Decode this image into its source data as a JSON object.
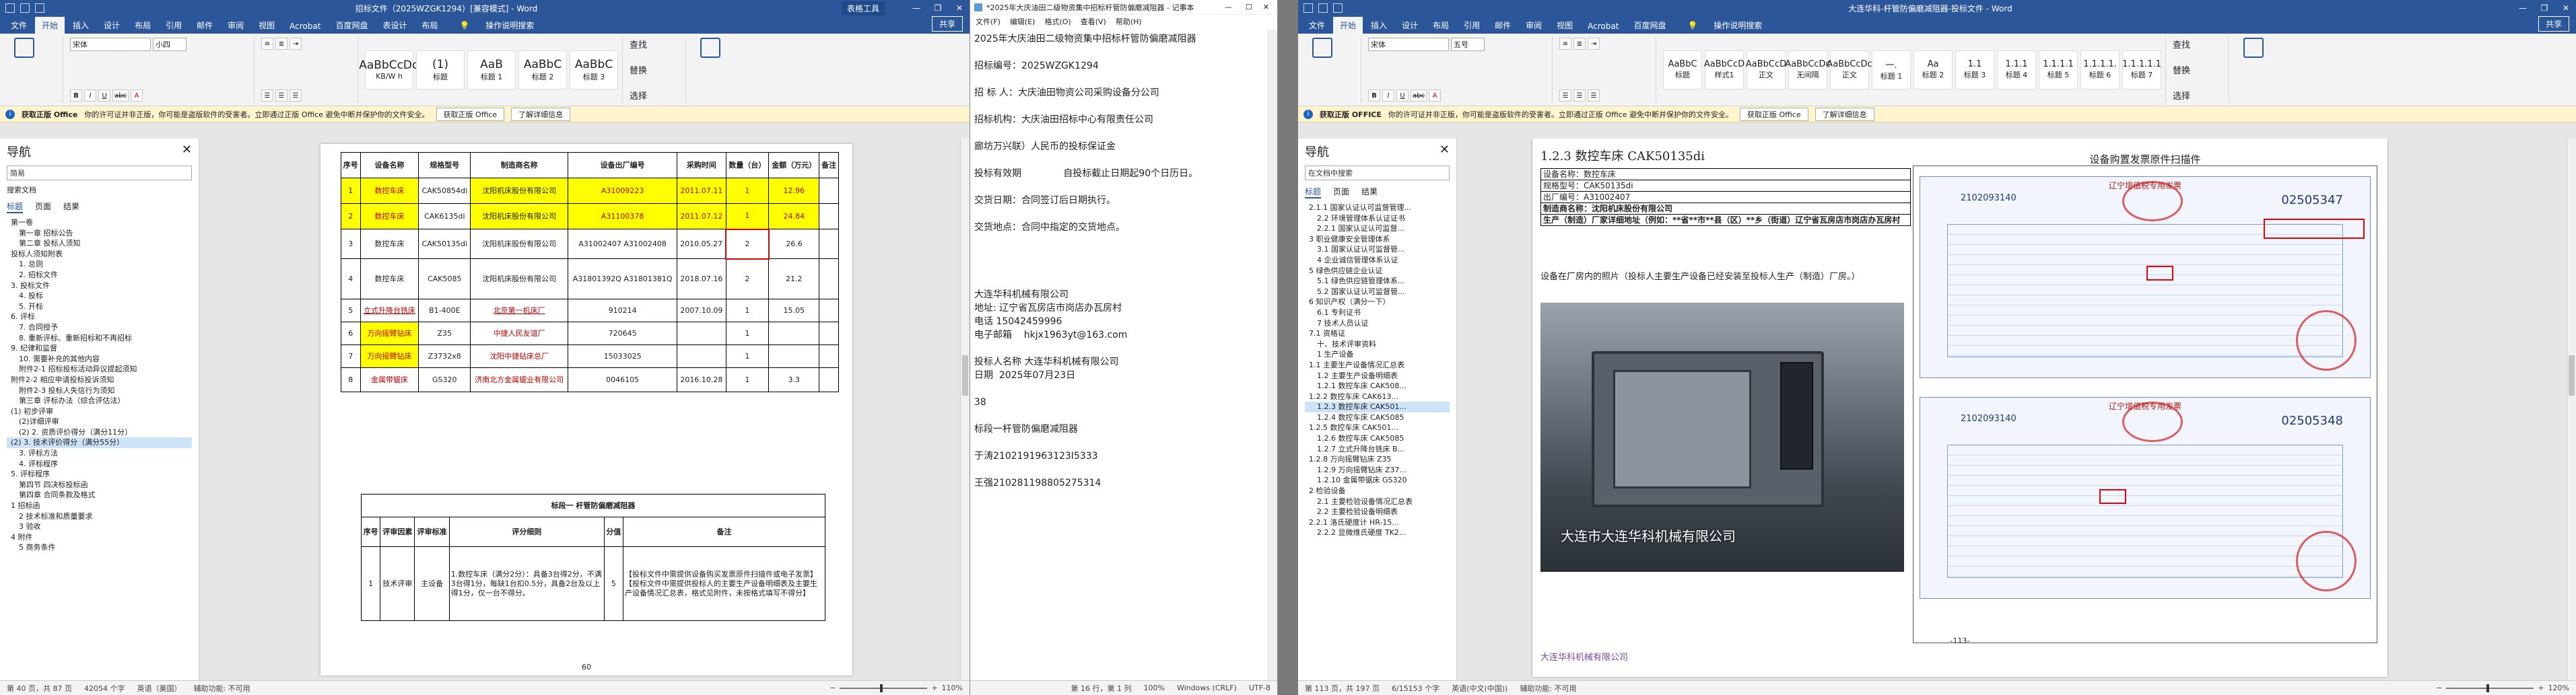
{
  "word1": {
    "title": "招标文件（2025WZGK1294）[兼容模式] - Word",
    "context_tab": "表格工具",
    "share": "共享",
    "tabs": [
      "文件",
      "开始",
      "插入",
      "设计",
      "布局",
      "引用",
      "邮件",
      "审阅",
      "视图",
      "Acrobat",
      "百度网盘",
      "表设计",
      "布局"
    ],
    "tell_me": "操作说明搜索",
    "font_name": "宋体",
    "font_size": "小四",
    "styles": [
      {
        "preview": "AaBbCcDd",
        "name": "KB/W h"
      },
      {
        "preview": "(1)",
        "name": "标题"
      },
      {
        "preview": "AaB",
        "name": "标题 1"
      },
      {
        "preview": "AaBbC",
        "name": "标题 2"
      },
      {
        "preview": "AaBbC",
        "name": "标题 3"
      }
    ],
    "edit_items": [
      "查找",
      "替换",
      "选择"
    ],
    "msg": {
      "label": "获取正版 Office",
      "text": "你的许可证并非正版，你可能是盗版软件的受害者。立即通过正版 Office 避免中断并保护你的文件安全。",
      "b1": "获取正版 Office",
      "b2": "了解详细信息"
    },
    "nav": {
      "title": "导航",
      "search": "简易",
      "hint": "搜索文档",
      "tabs": [
        "标题",
        "页面",
        "结果"
      ],
      "items": [
        "第一卷",
        "第一章 招标公告",
        "第二章 投标人须知",
        "投标人须知附表",
        "1. 总则",
        "2. 招标文件",
        "3. 投标文件",
        "4. 投标",
        "5. 开标",
        "6. 评标",
        "7. 合同授予",
        "8. 重新评标、重新招标和不再招标",
        "9. 纪律和监督",
        "10. 需要补充的其他内容",
        "附件2-1 招标投标活动异议提起须知",
        "附件2-2 相应申请投标投诉须知",
        "附件2-3 投标人失信行为须知",
        "第三章 评标办法（综合评估法）",
        "(1) 初步评审",
        "(2)详细评审",
        "(2) 2. 资质评价得分（满分11分）",
        "(2) 3. 技术评价得分（满分55分）",
        "3. 评标方法",
        "4. 评标程序",
        "5. 评标程序",
        "第四节 四决标投标函",
        "第四章 合同条款及格式",
        "1 招标函",
        "2 技术标准和质量要求",
        "3 验收",
        "4 附件",
        "5 商务条件"
      ],
      "selected": 21
    },
    "table": {
      "headers": [
        "序号",
        "设备名称",
        "规格型号",
        "制造商名称",
        "设备出厂编号",
        "采购时间",
        "数量（台）",
        "金额（万元）",
        "备注"
      ],
      "rows": [
        [
          "1",
          "数控车床",
          "CAK50854di",
          "沈阳机床股份有限公司",
          "A31009223",
          "2011.07.11",
          "1",
          "12.96",
          ""
        ],
        [
          "2",
          "数控车床",
          "CAK6135di",
          "沈阳机床股份有限公司",
          "A31100378",
          "2011.07.12",
          "1",
          "24.84",
          ""
        ],
        [
          "3",
          "数控车床",
          "CAK50135di",
          "沈阳机床股份有限公司",
          "A31002407 A31002408",
          "2010.05.27",
          "2",
          "26.6",
          ""
        ],
        [
          "4",
          "数控车床",
          "CAK5085",
          "沈阳机床股份有限公司",
          "A31801392Q A31801381Q",
          "2018.07.16",
          "2",
          "21.2",
          ""
        ],
        [
          "5",
          "立式升降台铣床",
          "B1-400E",
          "北京第一机床厂",
          "910214",
          "2007.10.09",
          "1",
          "15.05",
          ""
        ],
        [
          "6",
          "万向摇臂钻床",
          "Z35",
          "中捷人民友谊厂",
          "720645",
          "",
          "1",
          "",
          ""
        ],
        [
          "7",
          "万向摇臂钻床",
          "Z3732x8",
          "沈阳中捷钻床总厂",
          "15033025",
          "",
          "1",
          "",
          ""
        ],
        [
          "8",
          "金属带锯床",
          "GS320",
          "济南北方金属锯业有限公司",
          "0046105",
          "2016.10.28",
          "1",
          "3.3",
          ""
        ]
      ],
      "page_num": "60"
    },
    "table2": {
      "caption": "标段一 杆管防偏磨减阻器",
      "headers": [
        "序号",
        "评审因素",
        "评审标准",
        "评分细则",
        "分值",
        "备注"
      ],
      "cell_factor": "技术评审",
      "cell_sub": "主设备",
      "cell_rule": "1.数控车床（满分2分）：具备3台得2分，不满3台得1分，每缺1台扣0.5分，具备2台及以上得1分，仅一台不得分。",
      "cell_score": "5",
      "cell_note": "【投标文件中需提供设备购买发票原件扫描件或电子发票】【投标文件中需提供投标人的主要生产设备明细表及主要生产设备情况汇总表，格式见附件，未按格式填写不得分】"
    },
    "status": {
      "page": "第 40 页，共 87 页",
      "words": "42054 个字",
      "lang": "英语（美国）",
      "acc": "辅助功能: 不可用",
      "zoom": "110%"
    }
  },
  "notepad": {
    "title": "*2025年大庆油田二级物资集中招标杆管防偏磨减阻器 - 记事本",
    "menu": [
      "文件(F)",
      "编辑(E)",
      "格式(O)",
      "查看(V)",
      "帮助(H)"
    ],
    "lines": [
      "2025年大庆油田二级物资集中招标杆管防偏磨减阻器",
      "",
      "招标编号：2025WZGK1294",
      "",
      "招 标 人：大庆油田物资公司采购设备分公司",
      "",
      "招标机构：大庆油田招标中心有限责任公司",
      "",
      "廊坊万兴联）人民币的投标保证金",
      "",
      "投标有效期              自投标截止日期起90个日历日。",
      "",
      "交货日期：合同签订后日期执行。",
      "",
      "交货地点：合同中指定的交货地点。",
      "",
      "",
      "",
      "",
      "大连华科机械有限公司",
      "地址: 辽宁省瓦房店市岗店办瓦房村",
      "电话 15042459996",
      "电子邮箱    hkjx1963yt@163.com",
      "",
      "投标人名称 大连华科机械有限公司",
      "日期  2025年07月23日",
      "",
      "38",
      "",
      "标段一杆管防偏磨减阻器",
      "",
      "于涛2102191963123I5333",
      "",
      "王强210281198805275314"
    ],
    "status": {
      "pos": "第 16 行，第 1 列",
      "zoom": "100%",
      "enc": "Windows (CRLF)",
      "charset": "UTF-8"
    }
  },
  "word2": {
    "title": "大连华科-杆管防偏磨减阻器-投标文件 - Word",
    "share": "共享",
    "tabs": [
      "文件",
      "开始",
      "插入",
      "设计",
      "布局",
      "引用",
      "邮件",
      "审阅",
      "视图",
      "Acrobat",
      "百度网盘"
    ],
    "tell_me": "操作说明搜索",
    "font_name": "宋体",
    "font_size": "五号",
    "styles": [
      {
        "preview": "AaBbC",
        "name": "标题"
      },
      {
        "preview": "AaBbCcD",
        "name": "样式1"
      },
      {
        "preview": "AaBbCcD",
        "name": "正文"
      },
      {
        "preview": "AaBbCcDc",
        "name": "无间隔"
      },
      {
        "preview": "AaBbCcDc",
        "name": "正文"
      },
      {
        "preview": "一.",
        "name": "标题 1"
      },
      {
        "preview": "Aa",
        "name": "标题 2"
      },
      {
        "preview": "1.1",
        "name": "标题 3"
      },
      {
        "preview": "1.1.1",
        "name": "标题 4"
      },
      {
        "preview": "1.1.1.1",
        "name": "标题 5"
      },
      {
        "preview": "1.1.1.1.",
        "name": "标题 6"
      },
      {
        "preview": "1.1.1.1.1",
        "name": "标题 7"
      }
    ],
    "edit_items": [
      "查找",
      "替换",
      "选择"
    ],
    "msg": {
      "label": "获取正版 OFFICE",
      "text": "你的许可证并非正版，你可能是盗版软件的受害者。立即通过正版 Office 避免中断并保护你的文件安全。",
      "b1": "获取正版 Office",
      "b2": "了解详细信息"
    },
    "nav": {
      "title": "导航",
      "search": "在文档中搜索",
      "tabs": [
        "标题",
        "页面",
        "结果"
      ],
      "items": [
        "2.1.1 国家认证认可监督管理...",
        "2.2 环境管理体系认证证书",
        "2.2.1 国家认证认可监督...",
        "3 职业健康安全管理体系",
        "3.1 国家认证认可监督管...",
        "4 企业诚信管理体系认证",
        "5 绿色供应链企业认证",
        "5.1 绿色供应链管理体系...",
        "5.2 国家认证认可监督管...",
        "6 知识产权（满分一下）",
        "6.1 专利证书",
        "7 技术人员认证",
        "7.1 资格证",
        "十、技术评审资料",
        "1 生产设备",
        "1.1 主要生产设备情况汇总表",
        "1.2 主要生产设备明细表",
        "1.2.1 数控车床 CAK508...",
        "1.2.2 数控车床 CAK613...",
        "1.2.3 数控车床 CAK501...",
        "1.2.4 数控车床 CAK5085",
        "1.2.5 数控车床 CAK501...",
        "1.2.6 数控车床 CAK5085",
        "1.2.7 立式升降台铣床 B...",
        "1.2.8 万向摇臂钻床 Z35",
        "1.2.9 万向摇臂钻床 Z37...",
        "1.2.10 金属带锯床 GS320",
        "2 检验设备",
        "2.1 主要检验设备情况汇总表",
        "2.2 主要检验设备明细表",
        "2.2.1 洛氏硬度计 HR-15...",
        "2.2.2 显微维氏硬度 TK2..."
      ],
      "selected": 19
    },
    "doc": {
      "heading": "1.2.3  数控车床 CAK50135di",
      "rows": [
        "设备名称：数控车床",
        "规格型号：CAK50135di",
        "出厂编号：A31002407",
        "制造商名称：沈阳机床股份有限公司",
        "生产（制造）厂家详细地址（例如：**省**市**县（区）**乡（街道）辽宁省瓦房店市岗店办瓦房村"
      ],
      "invoice_title": "设备购置发票原件扫描件",
      "body_text": "设备在厂房内的照片（投标人主要生产设备已经安装至投标人生产（制造）厂房。）",
      "watermark": "大连市大连华科机械有限公司",
      "inv1_code": "2102093140",
      "inv1_no": "02505347",
      "inv2_code": "2102093140",
      "inv2_no": "02505348",
      "inv_head": "辽宁增值税专用发票",
      "footer": "大连华科机械有限公司",
      "page_num": "-113-"
    },
    "status": {
      "page": "第 113 页，共 197 页",
      "words": "6/15153 个字",
      "lang": "英语(中文(中国))",
      "acc": "辅助功能: 不可用",
      "zoom": "120%"
    }
  },
  "colors": {
    "word_blue": "#2b579a",
    "highlight": "#ffff00",
    "alert_red": "#e00000",
    "msgbar": "#fff4ce"
  }
}
